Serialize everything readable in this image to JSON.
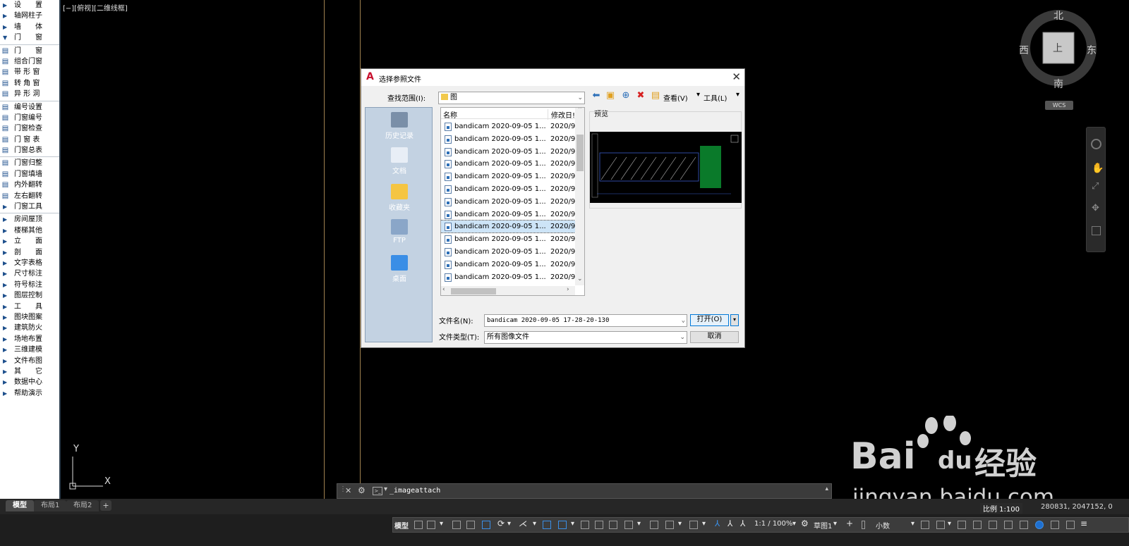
{
  "left_menu": {
    "items": [
      {
        "label": "设　　置",
        "kind": "tri"
      },
      {
        "label": "轴网柱子",
        "kind": "tri"
      },
      {
        "label": "墙　　体",
        "kind": "tri"
      },
      {
        "label": "门　　窗",
        "kind": "open"
      },
      {
        "label": "门　　窗",
        "kind": "icon"
      },
      {
        "label": "组合门窗",
        "kind": "icon"
      },
      {
        "label": "带 形 窗",
        "kind": "icon"
      },
      {
        "label": "转 角 窗",
        "kind": "icon"
      },
      {
        "label": "异 形 洞",
        "kind": "icon"
      },
      {
        "label": "编号设置",
        "kind": "icon"
      },
      {
        "label": "门窗编号",
        "kind": "icon"
      },
      {
        "label": "门窗检查",
        "kind": "icon"
      },
      {
        "label": "门 窗 表",
        "kind": "icon"
      },
      {
        "label": "门窗总表",
        "kind": "icon"
      },
      {
        "label": "门窗归整",
        "kind": "icon"
      },
      {
        "label": "门窗填墙",
        "kind": "icon"
      },
      {
        "label": "内外翻转",
        "kind": "icon"
      },
      {
        "label": "左右翻转",
        "kind": "icon"
      },
      {
        "label": "门窗工具",
        "kind": "tri"
      },
      {
        "label": "房间屋顶",
        "kind": "tri"
      },
      {
        "label": "楼梯其他",
        "kind": "tri"
      },
      {
        "label": "立　　面",
        "kind": "tri"
      },
      {
        "label": "剖　　面",
        "kind": "tri"
      },
      {
        "label": "文字表格",
        "kind": "tri"
      },
      {
        "label": "尺寸标注",
        "kind": "tri"
      },
      {
        "label": "符号标注",
        "kind": "tri"
      },
      {
        "label": "图层控制",
        "kind": "tri"
      },
      {
        "label": "工　　具",
        "kind": "tri"
      },
      {
        "label": "图块图案",
        "kind": "tri"
      },
      {
        "label": "建筑防火",
        "kind": "tri"
      },
      {
        "label": "场地布置",
        "kind": "tri"
      },
      {
        "label": "三维建模",
        "kind": "tri"
      },
      {
        "label": "文件布图",
        "kind": "tri"
      },
      {
        "label": "其　　它",
        "kind": "tri"
      },
      {
        "label": "数据中心",
        "kind": "tri"
      },
      {
        "label": "帮助演示",
        "kind": "tri"
      }
    ]
  },
  "viewport": {
    "label": "[−][俯视][二维线框]"
  },
  "ucs": {
    "x": "X",
    "y": "Y"
  },
  "viewcube": {
    "north": "北",
    "south": "南",
    "west": "西",
    "east": "东",
    "top": "上",
    "wcs": "WCS"
  },
  "dialog": {
    "title": "选择参照文件",
    "lookin_label": "查找范围(I):",
    "lookin_value": "图",
    "toolbar": {
      "views": "查看(V)",
      "tools": "工具(L)"
    },
    "places": [
      {
        "label": "历史记录",
        "icon": "history-icon"
      },
      {
        "label": "文档",
        "icon": "documents-icon"
      },
      {
        "label": "收藏夹",
        "icon": "favorites-icon"
      },
      {
        "label": "FTP",
        "icon": "ftp-icon"
      },
      {
        "label": "桌面",
        "icon": "desktop-icon"
      }
    ],
    "columns": {
      "name": "名称",
      "modified": "修改日!"
    },
    "files": [
      {
        "name": "bandicam 2020-09-05 1...",
        "date": "2020/9"
      },
      {
        "name": "bandicam 2020-09-05 1...",
        "date": "2020/9"
      },
      {
        "name": "bandicam 2020-09-05 1...",
        "date": "2020/9"
      },
      {
        "name": "bandicam 2020-09-05 1...",
        "date": "2020/9"
      },
      {
        "name": "bandicam 2020-09-05 1...",
        "date": "2020/9"
      },
      {
        "name": "bandicam 2020-09-05 1...",
        "date": "2020/9"
      },
      {
        "name": "bandicam 2020-09-05 1...",
        "date": "2020/9"
      },
      {
        "name": "bandicam 2020-09-05 1...",
        "date": "2020/9"
      },
      {
        "name": "bandicam 2020-09-05 1...",
        "date": "2020/9",
        "selected": true
      },
      {
        "name": "bandicam 2020-09-05 1...",
        "date": "2020/9"
      },
      {
        "name": "bandicam 2020-09-05 1...",
        "date": "2020/9"
      },
      {
        "name": "bandicam 2020-09-05 1...",
        "date": "2020/9"
      },
      {
        "name": "bandicam 2020-09-05 1...",
        "date": "2020/9"
      }
    ],
    "preview_label": "预览",
    "filename_label": "文件名(N):",
    "filename_value": "bandicam 2020-09-05 17-28-20-130",
    "filetype_label": "文件类型(T):",
    "filetype_value": "所有图像文件",
    "open_button": "打开(O)",
    "cancel_button": "取消"
  },
  "command_line": {
    "text": "_imageattach"
  },
  "layout_tabs": [
    {
      "label": "模型",
      "active": true
    },
    {
      "label": "布局1",
      "active": false
    },
    {
      "label": "布局2",
      "active": false
    }
  ],
  "status": {
    "coords": "280831, 2047152, 0",
    "scale": "比例 1:100",
    "model": "模型",
    "annotation_scale": "1:1 / 100%",
    "workspace": "草图1",
    "units": "小数"
  },
  "watermark": {
    "brand": "Bai",
    "brand2": "du",
    "cn": "经验",
    "url": "jingyan.baidu.com"
  }
}
